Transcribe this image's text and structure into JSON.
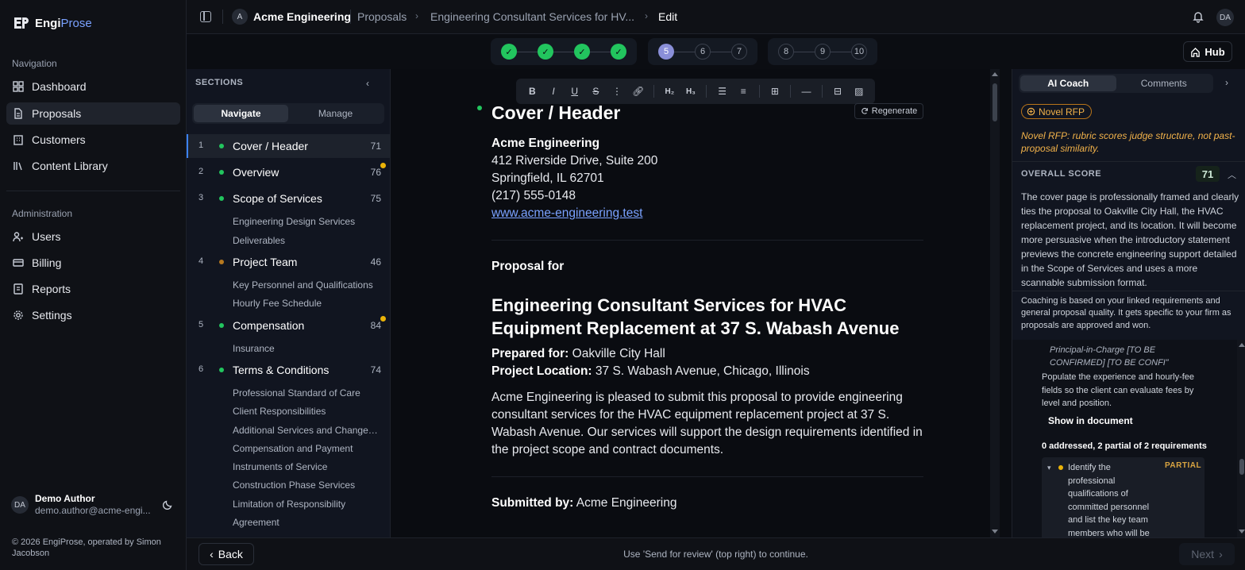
{
  "brand": {
    "name_part1": "Engi",
    "name_part2": "Prose"
  },
  "nav": {
    "title": "Navigation",
    "items": [
      {
        "label": "Dashboard",
        "icon": "dashboard-icon"
      },
      {
        "label": "Proposals",
        "icon": "document-icon",
        "active": true
      },
      {
        "label": "Customers",
        "icon": "building-icon"
      },
      {
        "label": "Content Library",
        "icon": "library-icon"
      }
    ]
  },
  "admin": {
    "title": "Administration",
    "items": [
      {
        "label": "Users",
        "icon": "users-icon"
      },
      {
        "label": "Billing",
        "icon": "credit-card-icon"
      },
      {
        "label": "Reports",
        "icon": "reports-icon"
      },
      {
        "label": "Settings",
        "icon": "gear-icon"
      }
    ]
  },
  "user": {
    "initials": "DA",
    "name": "Demo Author",
    "email": "demo.author@acme-engi..."
  },
  "footer": {
    "copyright": "© 2026 EngiProse, operated by Simon Jacobson"
  },
  "topbar": {
    "org_initial": "A",
    "org_name": "Acme Engineering",
    "crumb_proposals": "Proposals",
    "crumb_proposal": "Engineering Consultant Services for HV...",
    "crumb_edit": "Edit",
    "user_initials": "DA"
  },
  "stepper": {
    "group1": [
      "✓",
      "✓",
      "✓",
      "✓"
    ],
    "group2": [
      "5",
      "6",
      "7"
    ],
    "group3": [
      "8",
      "9",
      "10"
    ],
    "hub_label": "Hub"
  },
  "sections": {
    "title": "SECTIONS",
    "tabs": {
      "navigate": "Navigate",
      "manage": "Manage"
    },
    "items": [
      {
        "num": "1",
        "label": "Cover / Header",
        "score": "71",
        "status": "#22c55e"
      },
      {
        "num": "2",
        "label": "Overview",
        "score": "76",
        "status": "#22c55e"
      },
      {
        "num": "3",
        "label": "Scope of Services",
        "score": "75",
        "status": "#22c55e"
      },
      {
        "num": "4",
        "label": "Project Team",
        "score": "46",
        "status": "#b7791f"
      },
      {
        "num": "5",
        "label": "Compensation",
        "score": "84",
        "status": "#22c55e"
      },
      {
        "num": "6",
        "label": "Terms & Conditions",
        "score": "74",
        "status": "#22c55e"
      }
    ],
    "subs": {
      "s3": [
        "Engineering Design Services",
        "Deliverables"
      ],
      "s4": [
        "Key Personnel and Qualifications",
        "Hourly Fee Schedule"
      ],
      "s5": [
        "Insurance"
      ],
      "s6": [
        "Professional Standard of Care",
        "Client Responsibilities",
        "Additional Services and Changes ...",
        "Compensation and Payment",
        "Instruments of Service",
        "Construction Phase Services",
        "Limitation of Responsibility",
        "Agreement"
      ]
    }
  },
  "editor": {
    "regenerate": "Regenerate",
    "heading": "Cover / Header",
    "company": "Acme Engineering",
    "address1": "412 Riverside Drive, Suite 200",
    "address2": "Springfield, IL 62701",
    "phone": "(217) 555-0148",
    "website": "www.acme-engineering.test",
    "proposal_for": "Proposal for",
    "title": "Engineering Consultant Services for HVAC Equipment Replacement at 37 S. Wabash Avenue",
    "prepared_label": "Prepared for:",
    "prepared_value": " Oakville City Hall",
    "location_label": "Project Location:",
    "location_value": " 37 S. Wabash Avenue, Chicago, Illinois",
    "intro": "Acme Engineering is pleased to submit this proposal to provide engineering consultant services for the HVAC equipment replacement project at 37 S. Wabash Avenue. Our services will support the design requirements identified in the project scope and contract documents.",
    "submitted_label": "Submitted by:",
    "submitted_value": " Acme Engineering"
  },
  "coach": {
    "tab_ai": "AI Coach",
    "tab_comments": "Comments",
    "rfp_badge": "Novel RFP",
    "rfp_note": "Novel RFP: rubric scores judge structure, not past-proposal similarity.",
    "overall_label": "OVERALL SCORE",
    "overall_score": "71",
    "summary": "The cover page is professionally framed and clearly ties the proposal to Oakville City Hall, the HVAC replacement project, and its location. It will become more persuasive when the introductory statement previews the concrete engineering support detailed in the Scope of Services and uses a more scannable submission format.",
    "footnote": "Coaching is based on your linked requirements and general proposal quality. It gets specific to your firm as proposals are approved and won.",
    "req_quote": "Principal-in-Charge [TO BE CONFIRMED] [TO BE CONFI”",
    "req_body": "Populate the experience and hourly-fee fields so the client can evaluate fees by level and position.",
    "show_doc": "Show in document",
    "req_summary": "0 addressed, 2 partial of 2 requirements",
    "req_text": "Identify the professional qualifications of committed personnel and list the key team members who will be staffed throughout the",
    "req_status": "PARTIAL"
  },
  "bottom": {
    "back": "Back",
    "hint": "Use 'Send for review' (top right) to continue.",
    "next": "Next"
  }
}
